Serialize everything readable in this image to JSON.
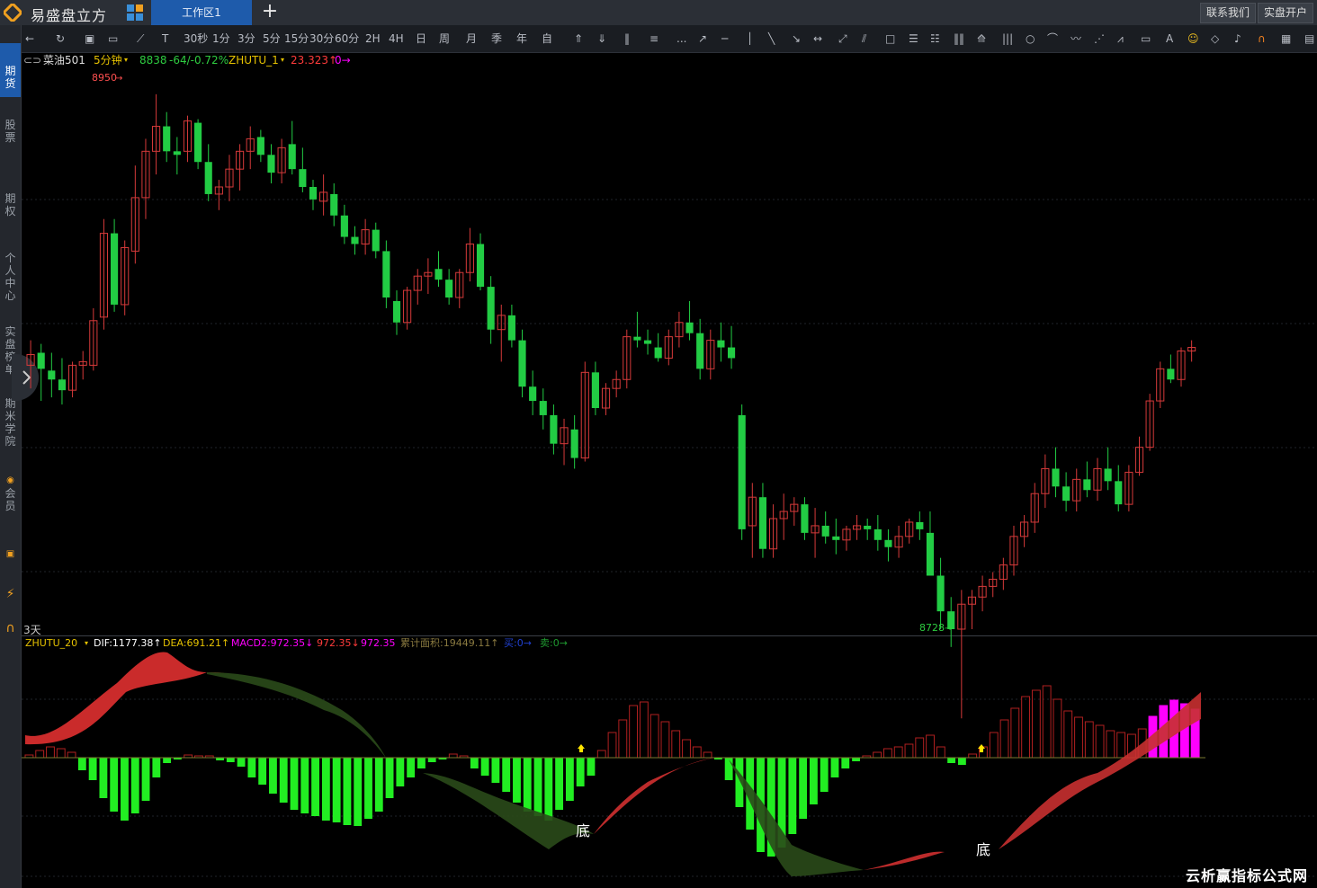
{
  "app": {
    "brand": "易盛盘立方",
    "workspace_tab": "工作区1",
    "contact_btn": "联系我们",
    "account_btn": "实盘开户"
  },
  "sidebar": {
    "items": [
      {
        "label": "期\n货",
        "active": true
      },
      {
        "label": "股\n票"
      },
      {
        "label": "期\n权"
      },
      {
        "label": "个\n人\n中\n心"
      },
      {
        "label": "实\n盘\n榜\n单"
      },
      {
        "label": "期\n米\n学\n院"
      },
      {
        "label": "会\n员"
      }
    ]
  },
  "toolbar": {
    "periods": [
      "30秒",
      "1分",
      "3分",
      "5分",
      "15分",
      "30分",
      "60分",
      "2H",
      "4H",
      "日",
      "周",
      "月",
      "季",
      "年",
      "自"
    ],
    "more": "..."
  },
  "quote": {
    "symbol": "菜油501",
    "period": "5分钟",
    "price": "8838",
    "change": "-64/-0.72%",
    "indicator": "ZHUTU_1",
    "indicator_value": "23.323↑",
    "indicator_value2": "0→",
    "colors": {
      "up": "#ff3b3b",
      "down": "#2ecc40",
      "magenta": "#ff00ff",
      "yellow": "#e6c200"
    }
  },
  "price_panel": {
    "high_label": "8950",
    "low_label": "8728",
    "period_label": "3天"
  },
  "macd": {
    "name": "ZHUTU_20",
    "dif": "DIF:1177.38↑",
    "dea": "DEA:691.21↑",
    "macd2": "MACD2:972.35↓",
    "v2": "972.35↓",
    "v3": "972.35",
    "area": "累计面积:19449.11↑",
    "buy": "买:0→",
    "sell": "卖:0→",
    "bottom_label": "底"
  },
  "watermark": "云析赢指标公式网",
  "chart_data": {
    "type": "candlestick",
    "candles_ohlc": [
      [
        8798,
        8812,
        8785,
        8804
      ],
      [
        8805,
        8810,
        8778,
        8796
      ],
      [
        8795,
        8805,
        8780,
        8790
      ],
      [
        8790,
        8802,
        8776,
        8784
      ],
      [
        8784,
        8800,
        8780,
        8798
      ],
      [
        8798,
        8806,
        8790,
        8800
      ],
      [
        8798,
        8830,
        8795,
        8823
      ],
      [
        8825,
        8880,
        8818,
        8872
      ],
      [
        8872,
        8880,
        8828,
        8832
      ],
      [
        8832,
        8868,
        8826,
        8864
      ],
      [
        8862,
        8910,
        8855,
        8892
      ],
      [
        8892,
        8925,
        8880,
        8918
      ],
      [
        8918,
        8950,
        8905,
        8932
      ],
      [
        8932,
        8940,
        8912,
        8918
      ],
      [
        8918,
        8926,
        8905,
        8916
      ],
      [
        8918,
        8938,
        8912,
        8935
      ],
      [
        8934,
        8936,
        8908,
        8912
      ],
      [
        8912,
        8922,
        8890,
        8894
      ],
      [
        8894,
        8902,
        8885,
        8898
      ],
      [
        8898,
        8916,
        8890,
        8908
      ],
      [
        8908,
        8922,
        8896,
        8918
      ],
      [
        8918,
        8932,
        8908,
        8925
      ],
      [
        8926,
        8930,
        8912,
        8916
      ],
      [
        8916,
        8922,
        8900,
        8906
      ],
      [
        8906,
        8925,
        8900,
        8920
      ],
      [
        8922,
        8935,
        8905,
        8908
      ],
      [
        8908,
        8920,
        8895,
        8898
      ],
      [
        8898,
        8902,
        8885,
        8891
      ],
      [
        8890,
        8905,
        8882,
        8895
      ],
      [
        8894,
        8900,
        8876,
        8882
      ],
      [
        8882,
        8888,
        8866,
        8870
      ],
      [
        8870,
        8876,
        8860,
        8866
      ],
      [
        8866,
        8880,
        8860,
        8874
      ],
      [
        8874,
        8878,
        8858,
        8862
      ],
      [
        8862,
        8868,
        8830,
        8836
      ],
      [
        8834,
        8840,
        8815,
        8822
      ],
      [
        8822,
        8842,
        8818,
        8840
      ],
      [
        8840,
        8852,
        8832,
        8848
      ],
      [
        8848,
        8858,
        8838,
        8850
      ],
      [
        8852,
        8862,
        8842,
        8846
      ],
      [
        8846,
        8852,
        8832,
        8836
      ],
      [
        8836,
        8852,
        8830,
        8850
      ],
      [
        8850,
        8875,
        8845,
        8866
      ],
      [
        8866,
        8872,
        8840,
        8842
      ],
      [
        8842,
        8848,
        8810,
        8818
      ],
      [
        8818,
        8832,
        8800,
        8826
      ],
      [
        8826,
        8832,
        8808,
        8812
      ],
      [
        8812,
        8818,
        8780,
        8786
      ],
      [
        8786,
        8795,
        8770,
        8778
      ],
      [
        8778,
        8785,
        8762,
        8770
      ],
      [
        8770,
        8776,
        8748,
        8754
      ],
      [
        8754,
        8768,
        8742,
        8763
      ],
      [
        8762,
        8770,
        8740,
        8746
      ],
      [
        8746,
        8800,
        8744,
        8794
      ],
      [
        8794,
        8800,
        8770,
        8774
      ],
      [
        8774,
        8788,
        8770,
        8785
      ],
      [
        8785,
        8795,
        8780,
        8790
      ],
      [
        8790,
        8818,
        8785,
        8814
      ],
      [
        8814,
        8828,
        8808,
        8812
      ],
      [
        8812,
        8818,
        8804,
        8810
      ],
      [
        8808,
        8816,
        8800,
        8802
      ],
      [
        8802,
        8818,
        8798,
        8814
      ],
      [
        8814,
        8828,
        8808,
        8822
      ],
      [
        8822,
        8834,
        8812,
        8816
      ],
      [
        8816,
        8824,
        8790,
        8796
      ],
      [
        8796,
        8818,
        8790,
        8812
      ],
      [
        8812,
        8822,
        8800,
        8808
      ],
      [
        8808,
        8820,
        8796,
        8802
      ]
    ],
    "gap_candles_ohlc": [
      [
        8770,
        8776,
        8700,
        8706
      ],
      [
        8708,
        8732,
        8690,
        8724
      ],
      [
        8724,
        8732,
        8690,
        8695
      ],
      [
        8695,
        8720,
        8690,
        8712
      ],
      [
        8712,
        8726,
        8700,
        8716
      ],
      [
        8716,
        8724,
        8708,
        8720
      ],
      [
        8720,
        8724,
        8700,
        8704
      ],
      [
        8704,
        8718,
        8690,
        8708
      ],
      [
        8708,
        8716,
        8698,
        8702
      ],
      [
        8702,
        8712,
        8692,
        8700
      ],
      [
        8700,
        8708,
        8694,
        8706
      ],
      [
        8706,
        8714,
        8700,
        8708
      ],
      [
        8708,
        8712,
        8700,
        8706
      ],
      [
        8706,
        8714,
        8694,
        8700
      ],
      [
        8700,
        8706,
        8688,
        8696
      ],
      [
        8696,
        8708,
        8690,
        8702
      ],
      [
        8702,
        8712,
        8698,
        8710
      ],
      [
        8710,
        8716,
        8700,
        8706
      ],
      [
        8704,
        8716,
        8690,
        8680
      ],
      [
        8680,
        8690,
        8650,
        8660
      ],
      [
        8660,
        8668,
        8640,
        8650
      ],
      [
        8650,
        8672,
        8600,
        8664
      ],
      [
        8664,
        8672,
        8650,
        8668
      ],
      [
        8668,
        8680,
        8660,
        8674
      ],
      [
        8674,
        8682,
        8668,
        8678
      ],
      [
        8678,
        8690,
        8672,
        8686
      ],
      [
        8686,
        8708,
        8680,
        8702
      ],
      [
        8702,
        8714,
        8696,
        8710
      ],
      [
        8710,
        8732,
        8704,
        8726
      ],
      [
        8726,
        8748,
        8718,
        8740
      ],
      [
        8740,
        8752,
        8724,
        8730
      ],
      [
        8730,
        8738,
        8716,
        8722
      ],
      [
        8722,
        8740,
        8716,
        8734
      ],
      [
        8734,
        8744,
        8724,
        8728
      ],
      [
        8728,
        8746,
        8722,
        8740
      ],
      [
        8740,
        8752,
        8728,
        8733
      ],
      [
        8733,
        8742,
        8716,
        8720
      ],
      [
        8720,
        8742,
        8716,
        8738
      ],
      [
        8738,
        8758,
        8736,
        8752
      ],
      [
        8752,
        8782,
        8750,
        8778
      ],
      [
        8778,
        8800,
        8774,
        8796
      ],
      [
        8796,
        8804,
        8788,
        8790
      ],
      [
        8790,
        8808,
        8786,
        8806
      ],
      [
        8806,
        8812,
        8800,
        8808
      ]
    ],
    "ylim": [
      8650,
      8960
    ]
  }
}
